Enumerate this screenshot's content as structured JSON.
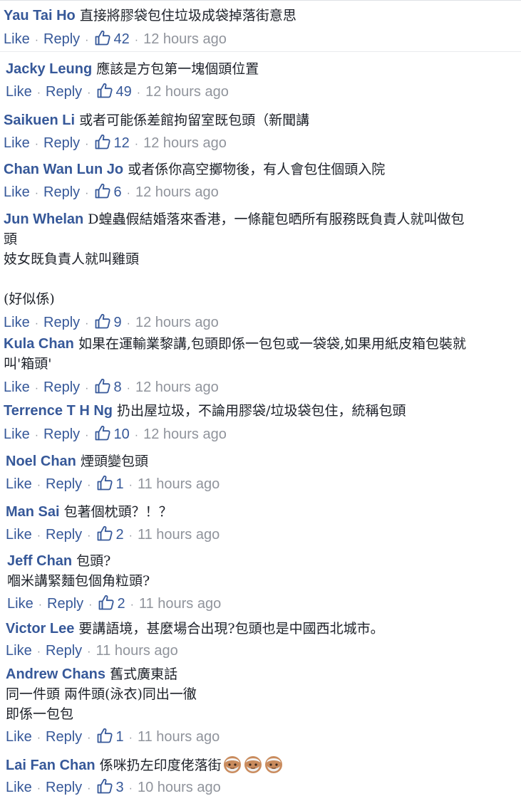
{
  "actions": {
    "like": "Like",
    "reply": "Reply"
  },
  "comments": [
    {
      "name": "Yau Tai Ho",
      "text": "直接將膠袋包住垃圾成袋掉落街意思",
      "likes": "42",
      "time": "12 hours ago"
    },
    {
      "name": "Jacky Leung",
      "text": "應該是方包第一塊個頭位置",
      "likes": "49",
      "time": "12 hours ago"
    },
    {
      "name": "Saikuen Li",
      "text": "或者可能係差館拘留室既包頭（新聞講",
      "likes": "12",
      "time": "12 hours ago"
    },
    {
      "name": "Chan Wan Lun Jo",
      "text": "或者係你高空擲物後，有人會包住個頭入院",
      "likes": "6",
      "time": "12 hours ago"
    },
    {
      "name": "Jun Whelan",
      "text": "D蝗蟲假結婚落來香港，一條龍包晒所有服務既負責人就叫做包\n頭\n妓女既負責人就叫雞頭\n\n(好似係)",
      "likes": "9",
      "time": "12 hours ago"
    },
    {
      "name": "Kula Chan",
      "text": "如果在運輸業黎講,包頭即係一包包或一袋袋,如果用紙皮箱包裝就\n叫'箱頭'",
      "likes": "8",
      "time": "12 hours ago"
    },
    {
      "name": "Terrence T H Ng",
      "text": "扔出屋垃圾，不論用膠袋/垃圾袋包住，統稱包頭",
      "likes": "10",
      "time": "12 hours ago"
    },
    {
      "name": "Noel Chan",
      "text": "煙頭變包頭",
      "likes": "1",
      "time": "11 hours ago"
    },
    {
      "name": "Man Sai",
      "text": "包著個枕頭？！？",
      "likes": "2",
      "time": "11 hours ago"
    },
    {
      "name": "Jeff Chan",
      "text": "包頭?\n嗰米講緊麵包個角粒頭?",
      "likes": "2",
      "time": "11 hours ago"
    },
    {
      "name": "Victor Lee",
      "text": "要講語境，甚麼場合出現?包頭也是中國西北城市。",
      "likes": "",
      "time": "11 hours ago"
    },
    {
      "name": "Andrew Chans",
      "text": "舊式廣東話\n同一件頭 兩件頭(泳衣)同出一徹\n即係一包包",
      "likes": "1",
      "time": "11 hours ago"
    },
    {
      "name": "Lai Fan Chan",
      "text": "係咪扔左印度佬落街",
      "emoji": [
        "older-man-emoji",
        "older-man-emoji",
        "older-man-emoji"
      ],
      "likes": "3",
      "time": "10 hours ago"
    }
  ]
}
